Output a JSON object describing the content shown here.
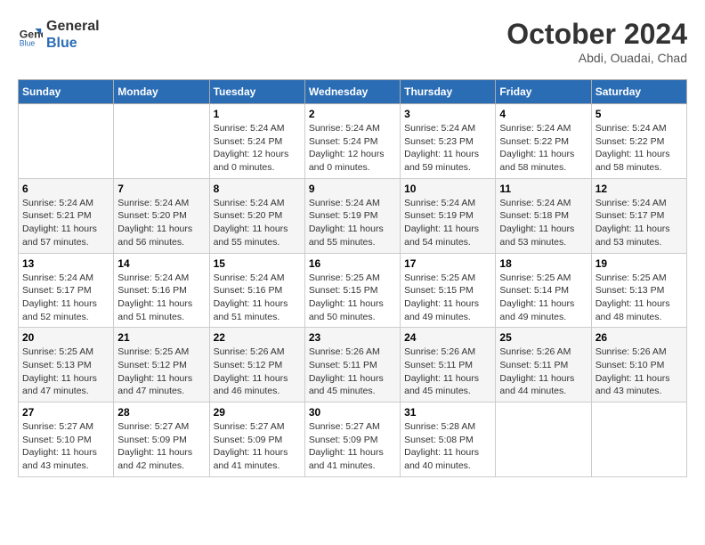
{
  "logo": {
    "line1": "General",
    "line2": "Blue"
  },
  "title": "October 2024",
  "location": "Abdi, Ouadai, Chad",
  "weekdays": [
    "Sunday",
    "Monday",
    "Tuesday",
    "Wednesday",
    "Thursday",
    "Friday",
    "Saturday"
  ],
  "weeks": [
    [
      {
        "day": null,
        "info": null
      },
      {
        "day": null,
        "info": null
      },
      {
        "day": "1",
        "info": "Sunrise: 5:24 AM\nSunset: 5:24 PM\nDaylight: 12 hours\nand 0 minutes."
      },
      {
        "day": "2",
        "info": "Sunrise: 5:24 AM\nSunset: 5:24 PM\nDaylight: 12 hours\nand 0 minutes."
      },
      {
        "day": "3",
        "info": "Sunrise: 5:24 AM\nSunset: 5:23 PM\nDaylight: 11 hours\nand 59 minutes."
      },
      {
        "day": "4",
        "info": "Sunrise: 5:24 AM\nSunset: 5:22 PM\nDaylight: 11 hours\nand 58 minutes."
      },
      {
        "day": "5",
        "info": "Sunrise: 5:24 AM\nSunset: 5:22 PM\nDaylight: 11 hours\nand 58 minutes."
      }
    ],
    [
      {
        "day": "6",
        "info": "Sunrise: 5:24 AM\nSunset: 5:21 PM\nDaylight: 11 hours\nand 57 minutes."
      },
      {
        "day": "7",
        "info": "Sunrise: 5:24 AM\nSunset: 5:20 PM\nDaylight: 11 hours\nand 56 minutes."
      },
      {
        "day": "8",
        "info": "Sunrise: 5:24 AM\nSunset: 5:20 PM\nDaylight: 11 hours\nand 55 minutes."
      },
      {
        "day": "9",
        "info": "Sunrise: 5:24 AM\nSunset: 5:19 PM\nDaylight: 11 hours\nand 55 minutes."
      },
      {
        "day": "10",
        "info": "Sunrise: 5:24 AM\nSunset: 5:19 PM\nDaylight: 11 hours\nand 54 minutes."
      },
      {
        "day": "11",
        "info": "Sunrise: 5:24 AM\nSunset: 5:18 PM\nDaylight: 11 hours\nand 53 minutes."
      },
      {
        "day": "12",
        "info": "Sunrise: 5:24 AM\nSunset: 5:17 PM\nDaylight: 11 hours\nand 53 minutes."
      }
    ],
    [
      {
        "day": "13",
        "info": "Sunrise: 5:24 AM\nSunset: 5:17 PM\nDaylight: 11 hours\nand 52 minutes."
      },
      {
        "day": "14",
        "info": "Sunrise: 5:24 AM\nSunset: 5:16 PM\nDaylight: 11 hours\nand 51 minutes."
      },
      {
        "day": "15",
        "info": "Sunrise: 5:24 AM\nSunset: 5:16 PM\nDaylight: 11 hours\nand 51 minutes."
      },
      {
        "day": "16",
        "info": "Sunrise: 5:25 AM\nSunset: 5:15 PM\nDaylight: 11 hours\nand 50 minutes."
      },
      {
        "day": "17",
        "info": "Sunrise: 5:25 AM\nSunset: 5:15 PM\nDaylight: 11 hours\nand 49 minutes."
      },
      {
        "day": "18",
        "info": "Sunrise: 5:25 AM\nSunset: 5:14 PM\nDaylight: 11 hours\nand 49 minutes."
      },
      {
        "day": "19",
        "info": "Sunrise: 5:25 AM\nSunset: 5:13 PM\nDaylight: 11 hours\nand 48 minutes."
      }
    ],
    [
      {
        "day": "20",
        "info": "Sunrise: 5:25 AM\nSunset: 5:13 PM\nDaylight: 11 hours\nand 47 minutes."
      },
      {
        "day": "21",
        "info": "Sunrise: 5:25 AM\nSunset: 5:12 PM\nDaylight: 11 hours\nand 47 minutes."
      },
      {
        "day": "22",
        "info": "Sunrise: 5:26 AM\nSunset: 5:12 PM\nDaylight: 11 hours\nand 46 minutes."
      },
      {
        "day": "23",
        "info": "Sunrise: 5:26 AM\nSunset: 5:11 PM\nDaylight: 11 hours\nand 45 minutes."
      },
      {
        "day": "24",
        "info": "Sunrise: 5:26 AM\nSunset: 5:11 PM\nDaylight: 11 hours\nand 45 minutes."
      },
      {
        "day": "25",
        "info": "Sunrise: 5:26 AM\nSunset: 5:11 PM\nDaylight: 11 hours\nand 44 minutes."
      },
      {
        "day": "26",
        "info": "Sunrise: 5:26 AM\nSunset: 5:10 PM\nDaylight: 11 hours\nand 43 minutes."
      }
    ],
    [
      {
        "day": "27",
        "info": "Sunrise: 5:27 AM\nSunset: 5:10 PM\nDaylight: 11 hours\nand 43 minutes."
      },
      {
        "day": "28",
        "info": "Sunrise: 5:27 AM\nSunset: 5:09 PM\nDaylight: 11 hours\nand 42 minutes."
      },
      {
        "day": "29",
        "info": "Sunrise: 5:27 AM\nSunset: 5:09 PM\nDaylight: 11 hours\nand 41 minutes."
      },
      {
        "day": "30",
        "info": "Sunrise: 5:27 AM\nSunset: 5:09 PM\nDaylight: 11 hours\nand 41 minutes."
      },
      {
        "day": "31",
        "info": "Sunrise: 5:28 AM\nSunset: 5:08 PM\nDaylight: 11 hours\nand 40 minutes."
      },
      {
        "day": null,
        "info": null
      },
      {
        "day": null,
        "info": null
      }
    ]
  ]
}
